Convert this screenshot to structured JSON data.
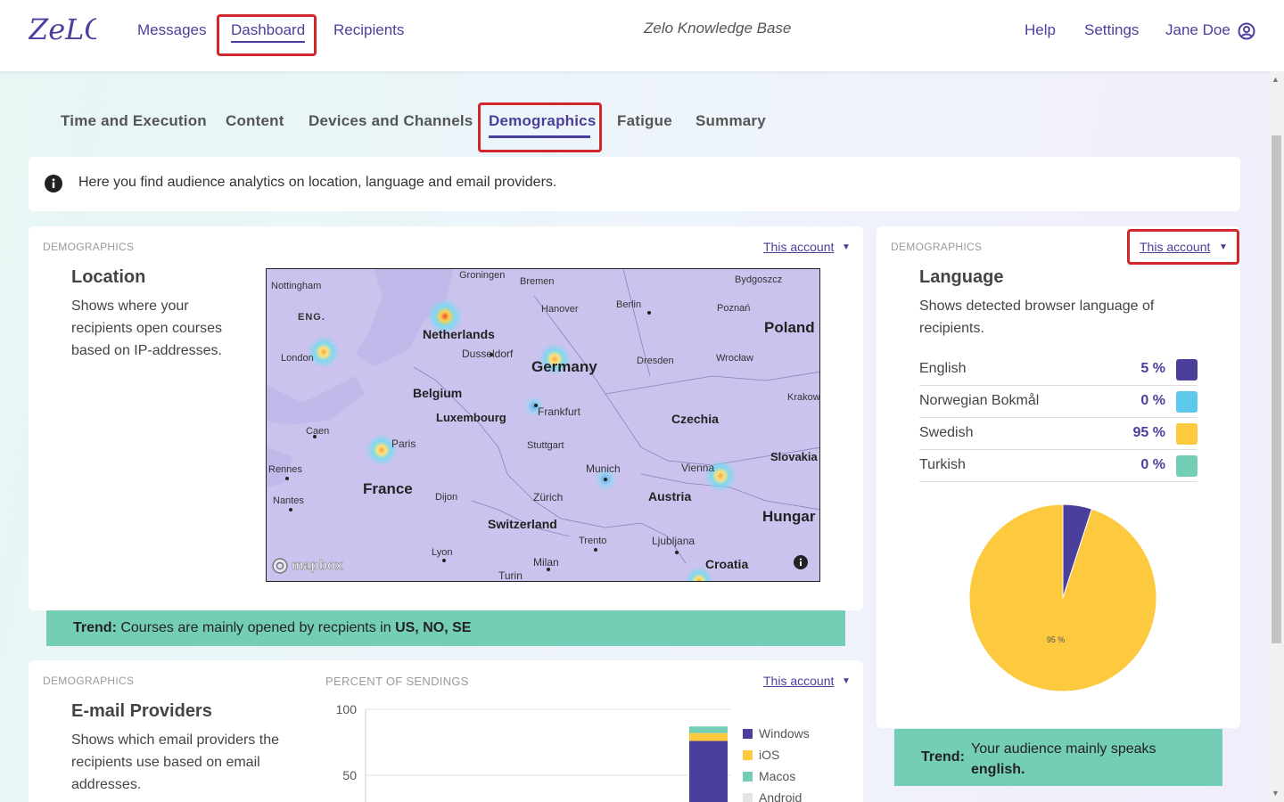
{
  "nav": {
    "logo": "ZeLO",
    "messages": "Messages",
    "dashboard": "Dashboard",
    "recipients": "Recipients",
    "kb_title": "Zelo Knowledge Base",
    "help": "Help",
    "settings": "Settings",
    "user": "Jane Doe"
  },
  "tabs": {
    "time": "Time and Execution",
    "content": "Content",
    "devices": "Devices and Channels",
    "demographics": "Demographics",
    "fatigue": "Fatigue",
    "summary": "Summary"
  },
  "info": {
    "text": "Here you find audience analytics on location, language and email providers."
  },
  "location": {
    "eyebrow": "DEMOGRAPHICS",
    "account": "This account",
    "title": "Location",
    "description": "Shows where your recipients open courses based on IP-addresses.",
    "trend_label": "Trend:",
    "trend_text": "Courses are mainly opened by recpients in",
    "trend_countries": "US, NO, SE",
    "map_attribution": "mapbox",
    "map_labels": {
      "nottingham": "Nottingham",
      "eng": "ENG.",
      "london": "London",
      "groningen": "Groningen",
      "bremen": "Bremen",
      "hanover": "Hanover",
      "berlin": "Berlin",
      "poznan": "Poznań",
      "bydgoszcz": "Bydgoszcz",
      "poland": "Poland",
      "netherlands": "Netherlands",
      "dusseldorf": "Dusseldorf",
      "germany": "Germany",
      "dresden": "Dresden",
      "wroclaw": "Wrocław",
      "belgium": "Belgium",
      "krakow": "Krakow",
      "luxembourg": "Luxembourg",
      "frankfurt": "Frankfurt",
      "czechia": "Czechia",
      "caen": "Caen",
      "paris": "Paris",
      "stuttgart": "Stuttgart",
      "rennes": "Rennes",
      "munich": "Munich",
      "vienna": "Vienna",
      "slovakia": "Slovakia",
      "france": "France",
      "dijon": "Dijon",
      "zurich": "Zürich",
      "austria": "Austria",
      "nantes": "Nantes",
      "hungary": "Hungar",
      "switzerland": "Switzerland",
      "trento": "Trento",
      "ljubljana": "Ljubljana",
      "lyon": "Lyon",
      "milan": "Milan",
      "croatia": "Croatia",
      "turin": "Turin"
    }
  },
  "language": {
    "eyebrow": "DEMOGRAPHICS",
    "account": "This account",
    "title": "Language",
    "description": "Shows detected browser language of recipients.",
    "items": [
      {
        "name": "English",
        "pct": "5 %",
        "color": "#4b3f9c"
      },
      {
        "name": "Norwegian Bokmål",
        "pct": "0 %",
        "color": "#5bc8ec"
      },
      {
        "name": "Swedish",
        "pct": "95 %",
        "color": "#fdc93f"
      },
      {
        "name": "Turkish",
        "pct": "0 %",
        "color": "#74cdb5"
      }
    ],
    "pie_label": "95 %",
    "trend_label": "Trend:",
    "trend_text": "Your audience mainly speaks",
    "trend_value": "english."
  },
  "email": {
    "eyebrow": "DEMOGRAPHICS",
    "chart_eyebrow": "PERCENT OF SENDINGS",
    "account": "This account",
    "title": "E-mail Providers",
    "description": "Shows which email providers the recipients use based on email addresses.",
    "y_ticks": [
      "100",
      "50"
    ],
    "legend": [
      {
        "name": "Windows",
        "color": "#4b3f9c"
      },
      {
        "name": "iOS",
        "color": "#fdc93f"
      },
      {
        "name": "Macos",
        "color": "#74cdb5"
      },
      {
        "name": "Android",
        "color": "#e4e4e4"
      }
    ]
  },
  "chart_data": [
    {
      "type": "pie",
      "title": "",
      "categories": [
        "English",
        "Norwegian Bokmål",
        "Swedish",
        "Turkish"
      ],
      "values": [
        5,
        0,
        95,
        0
      ],
      "colors": [
        "#4b3f9c",
        "#5bc8ec",
        "#fdc93f",
        "#74cdb5"
      ],
      "data_labels": [
        "",
        "",
        "95 %",
        ""
      ]
    },
    {
      "type": "bar",
      "title": "PERCENT OF SENDINGS",
      "stacked": true,
      "categories": [
        ""
      ],
      "series": [
        {
          "name": "Windows",
          "values": [
            76
          ]
        },
        {
          "name": "iOS",
          "values": [
            6
          ]
        },
        {
          "name": "Macos",
          "values": [
            5
          ]
        },
        {
          "name": "Android",
          "values": [
            0
          ]
        }
      ],
      "ylim": [
        0,
        100
      ],
      "y_ticks": [
        50,
        100
      ],
      "legend": "right"
    }
  ]
}
